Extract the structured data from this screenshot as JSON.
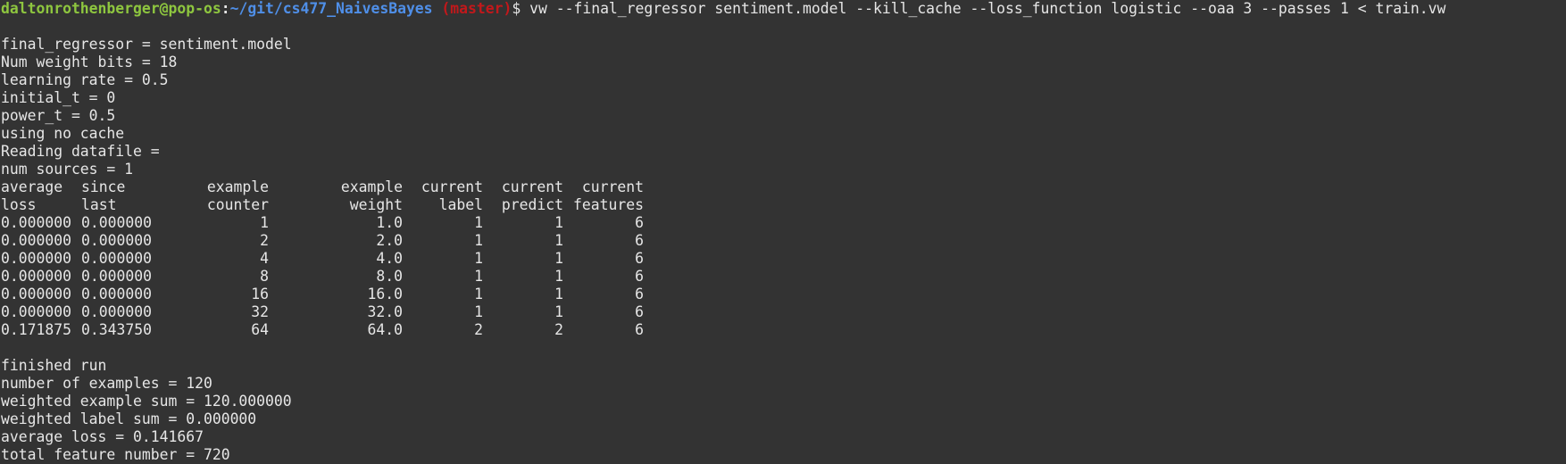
{
  "prompt": {
    "user_host": "daltonrothenberger@pop-os",
    "separator": ":",
    "path": "~/git/cs477_NaivesBayes",
    "branch": "(master)",
    "dollar": "$",
    "command": "vw --final_regressor sentiment.model --kill_cache --loss_function logistic --oaa 3 --passes 1 < train.vw"
  },
  "output_lines": [
    "final_regressor = sentiment.model",
    "Num weight bits = 18",
    "learning rate = 0.5",
    "initial_t = 0",
    "power_t = 0.5",
    "using no cache",
    "Reading datafile =",
    "num sources = 1"
  ],
  "table": {
    "header_row1": [
      "average",
      "since",
      "example",
      "example",
      "current",
      "current",
      "current"
    ],
    "header_row2": [
      "loss",
      "last",
      "counter",
      "weight",
      "label",
      "predict",
      "features"
    ],
    "rows": [
      [
        "0.000000",
        "0.000000",
        "1",
        "1.0",
        "1",
        "1",
        "6"
      ],
      [
        "0.000000",
        "0.000000",
        "2",
        "2.0",
        "1",
        "1",
        "6"
      ],
      [
        "0.000000",
        "0.000000",
        "4",
        "4.0",
        "1",
        "1",
        "6"
      ],
      [
        "0.000000",
        "0.000000",
        "8",
        "8.0",
        "1",
        "1",
        "6"
      ],
      [
        "0.000000",
        "0.000000",
        "16",
        "16.0",
        "1",
        "1",
        "6"
      ],
      [
        "0.000000",
        "0.000000",
        "32",
        "32.0",
        "1",
        "1",
        "6"
      ],
      [
        "0.171875",
        "0.343750",
        "64",
        "64.0",
        "2",
        "2",
        "6"
      ]
    ]
  },
  "summary_lines": [
    "finished run",
    "number of examples = 120",
    "weighted example sum = 120.000000",
    "weighted label sum = 0.000000",
    "average loss = 0.141667",
    "total feature number = 720"
  ],
  "colors": {
    "background": "#333333",
    "text": "#e6e6e6",
    "user_host": "#8ec63f",
    "path": "#4f8fe8",
    "branch": "#c2181b"
  }
}
